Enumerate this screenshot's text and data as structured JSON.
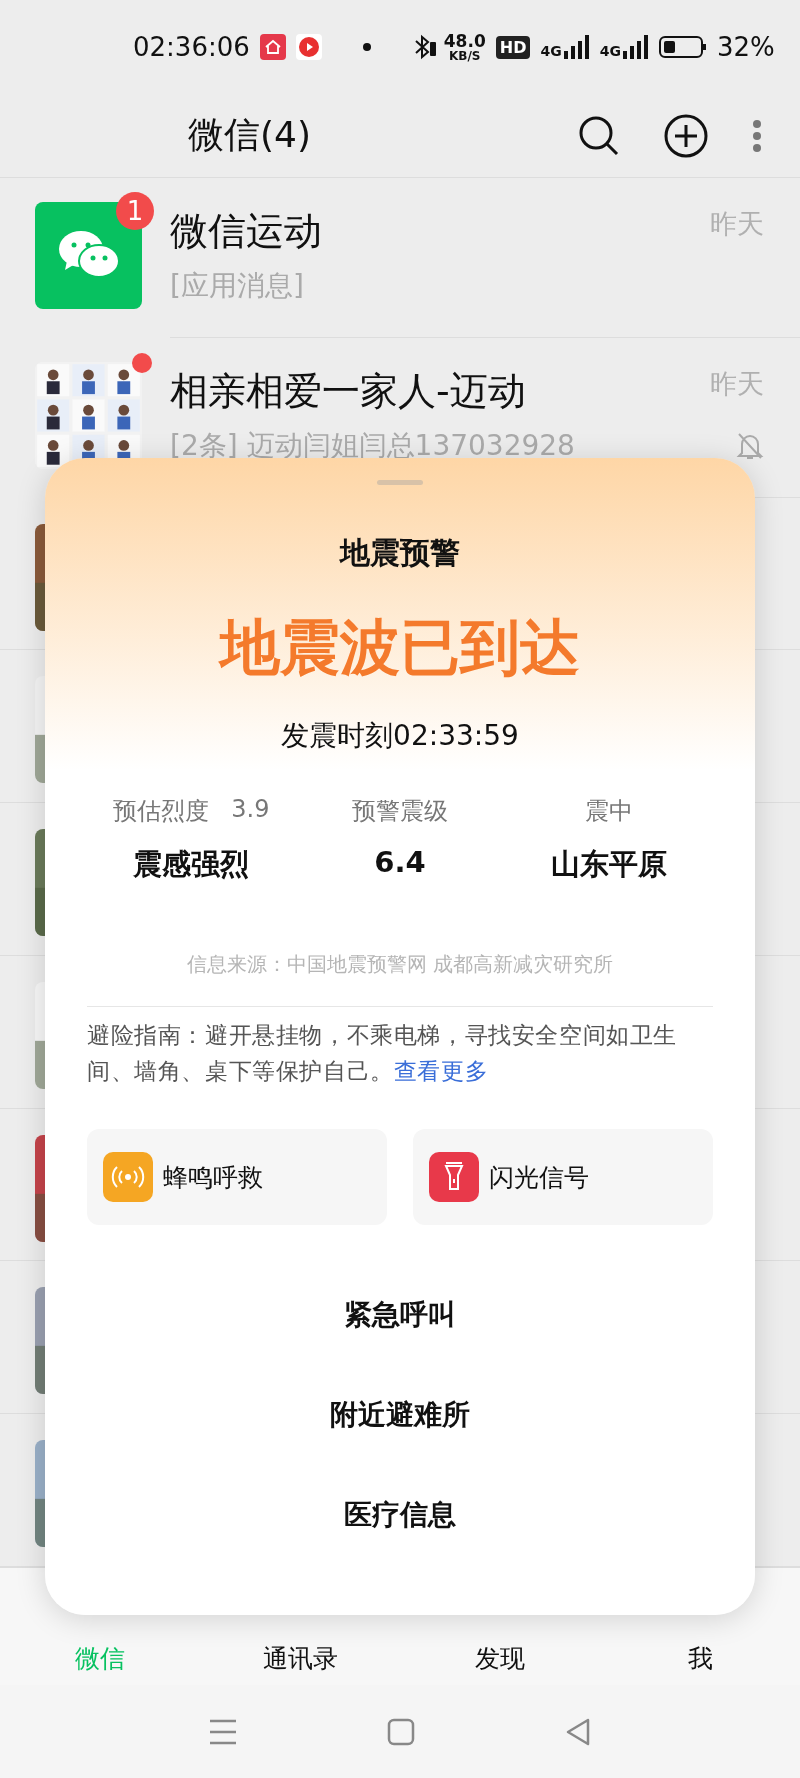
{
  "status_bar": {
    "time": "02:36:06",
    "speed": "48.0",
    "speed_unit": "KB/S",
    "hd": "HD",
    "network_1": "4G",
    "network_2": "4G",
    "battery": "32%"
  },
  "header": {
    "title": "微信(4)"
  },
  "chats": [
    {
      "kind": "app",
      "title": "微信运动",
      "preview": "[应用消息]",
      "time": "昨天",
      "badge": "1",
      "muted": false
    },
    {
      "kind": "group",
      "title": "相亲相爱一家人-迈动",
      "preview": "[2条] 迈动闫姐闫总137032928",
      "time": "昨天",
      "muted": true
    }
  ],
  "alert": {
    "title": "地震预警",
    "headline": "地震波已到达",
    "time": "发震时刻02:33:59",
    "stats": [
      {
        "label": "预估烈度",
        "extra": "3.9",
        "value": "震感强烈"
      },
      {
        "label": "预警震级",
        "value": "6.4"
      },
      {
        "label": "震中",
        "value": "山东平原"
      }
    ],
    "source": "信息来源：中国地震预警网 成都高新减灾研究所",
    "guide": "避险指南：避开悬挂物，不乘电梯，寻找安全空间如卫生间、墙角、桌下等保护自己。",
    "guide_link": "查看更多",
    "tools": [
      {
        "kind": "siren",
        "label": "蜂鸣呼救",
        "color": "#f5a623"
      },
      {
        "kind": "flashlight",
        "label": "闪光信号",
        "color": "#e8394a"
      }
    ],
    "actions": [
      "紧急呼叫",
      "附近避难所",
      "医疗信息"
    ]
  },
  "tabs": [
    {
      "label": "微信",
      "selected": true
    },
    {
      "label": "通讯录",
      "selected": false
    },
    {
      "label": "发现",
      "selected": false
    },
    {
      "label": "我",
      "selected": false
    }
  ]
}
